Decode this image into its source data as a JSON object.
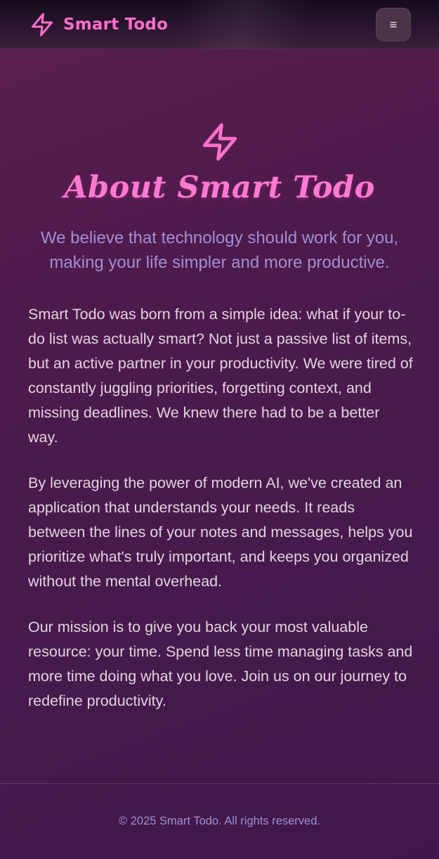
{
  "header": {
    "brand_name": "Smart Todo",
    "brand_icon": "lightning-bolt-icon",
    "menu_icon": "hamburger-menu-icon",
    "menu_glyph": "≡"
  },
  "hero": {
    "icon": "lightning-bolt-icon",
    "title": "About Smart Todo",
    "subtitle": "We believe that technology should work for you, making your life simpler and more productive."
  },
  "content": {
    "paragraphs": [
      "Smart Todo was born from a simple idea: what if your to-do list was actually smart? Not just a passive list of items, but an active partner in your productivity. We were tired of constantly juggling priorities, forgetting context, and missing deadlines. We knew there had to be a better way.",
      "By leveraging the power of modern AI, we've created an application that understands your needs. It reads between the lines of your notes and messages, helps you prioritize what's truly important, and keeps you organized without the mental overhead.",
      "Our mission is to give you back your most valuable resource: your time. Spend less time managing tasks and more time doing what you love. Join us on our journey to redefine productivity."
    ]
  },
  "footer": {
    "copyright": "© 2025 Smart Todo. All rights reserved."
  },
  "colors": {
    "accent_pink": "#ff6fc9",
    "subtitle_lavender": "#a08fd2",
    "body_text": "#e3d3e0",
    "background": "#4d1a4c"
  }
}
